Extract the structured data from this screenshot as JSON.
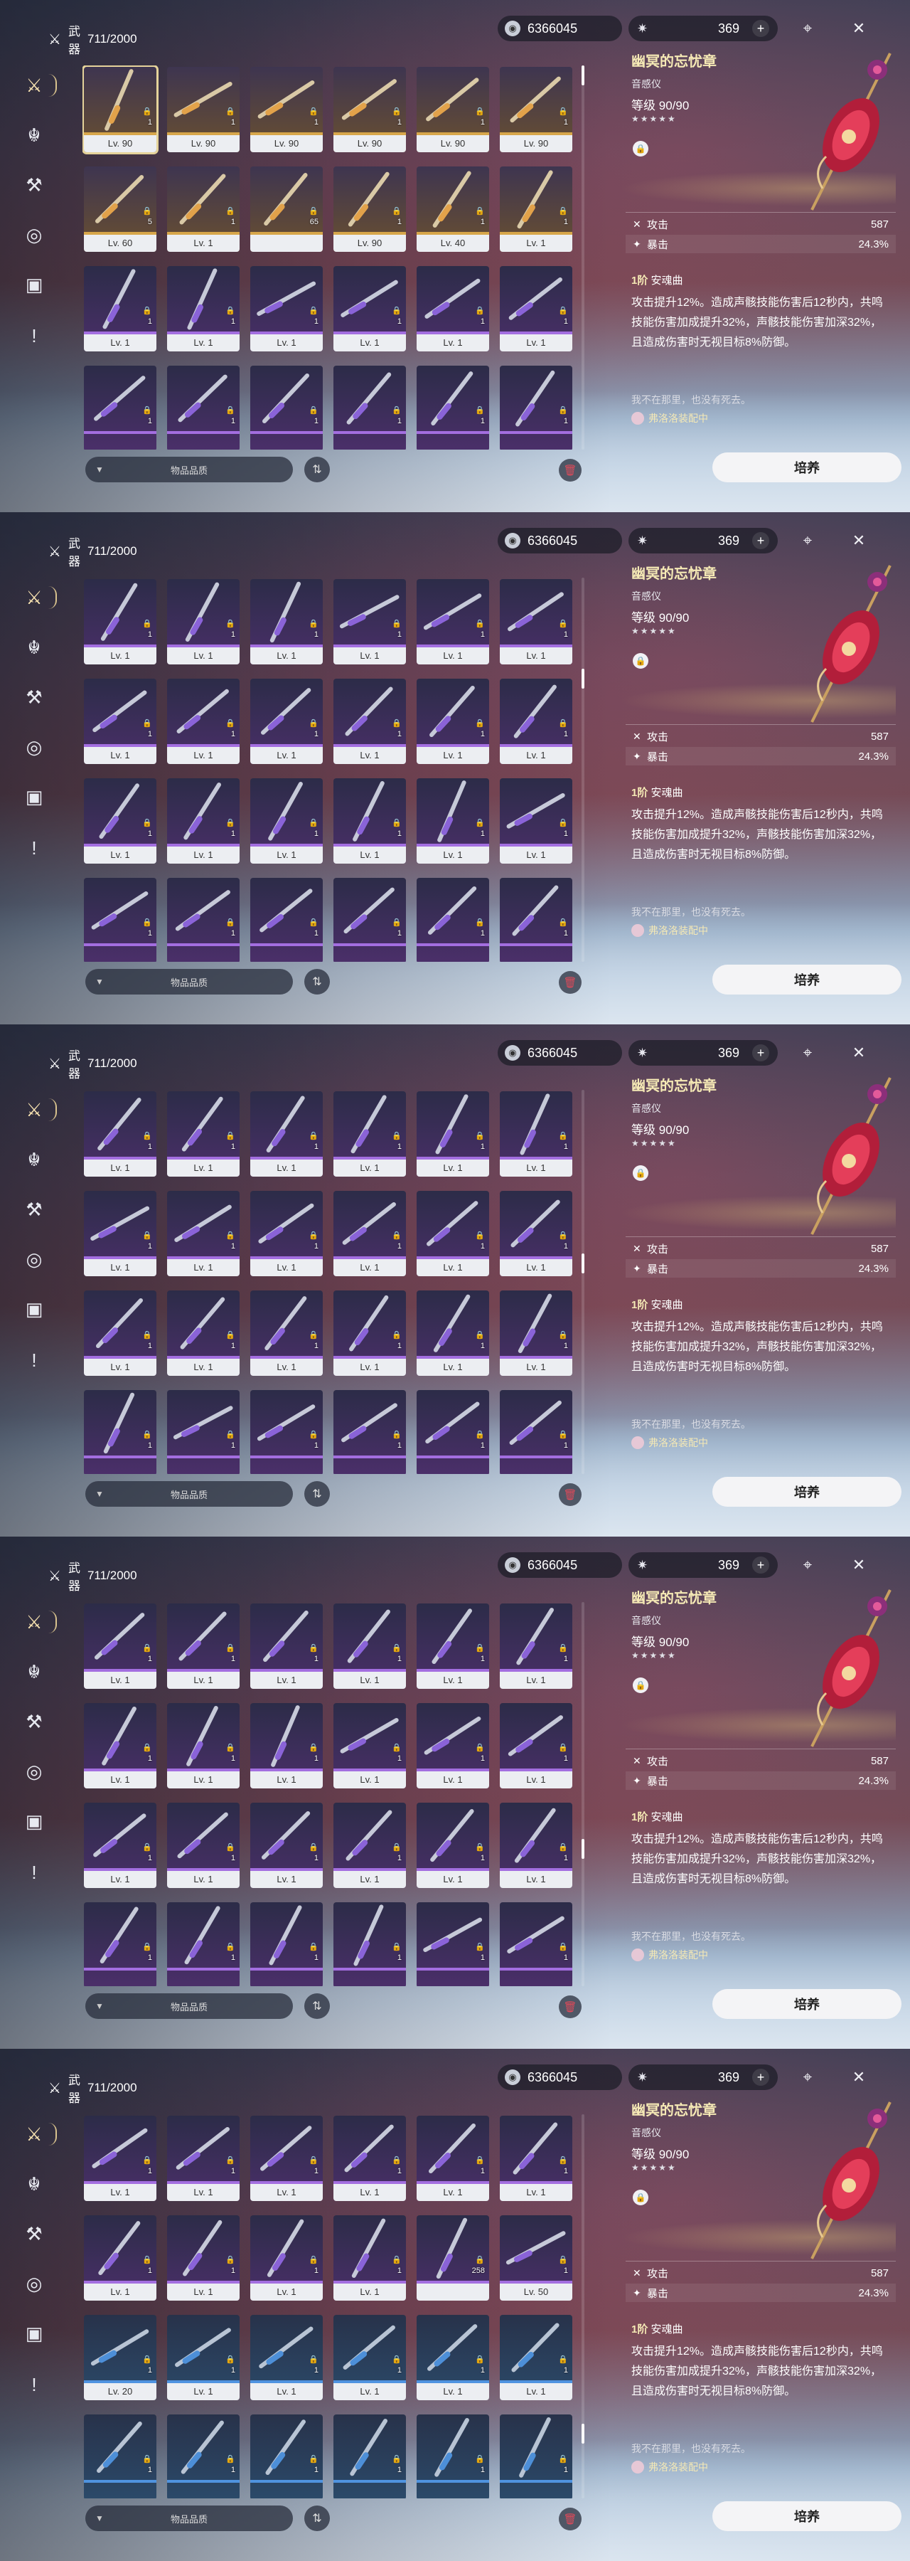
{
  "category": {
    "label": "武器",
    "count": "711/2000"
  },
  "currency": {
    "amount": "6366045"
  },
  "energy": {
    "amount": "369"
  },
  "filter_label": "物品品质",
  "cultivate_label": "培养",
  "weapon": {
    "name": "幽冥的忘忧章",
    "type": "音感仪",
    "level_label": "等级",
    "level": "90/90",
    "stars": "★★★★★",
    "stats": [
      {
        "name": "攻击",
        "value": "587"
      },
      {
        "name": "暴击",
        "value": "24.3%"
      }
    ],
    "rank": "1阶",
    "skill_name": "安魂曲",
    "skill_desc": "攻击提升12%。造成声骸技能伤害后12秒内，共鸣技能伤害加成提升32%，声骸技能伤害加深32%，且造成伤害时无视目标8%防御。",
    "flavor": "我不在那里，也没有死去。",
    "equipped": "弗洛洛装配中"
  },
  "colors": {
    "gold": "#d7a64a",
    "purple": "#a36ee0",
    "blue": "#4f93e0",
    "accent": "#f5e9b5"
  },
  "panels": [
    {
      "scroll": 0.0,
      "rows": [
        [
          [
            "q5",
            "Lv. 90",
            "1"
          ],
          [
            "q5",
            "Lv. 90",
            "1"
          ],
          [
            "q5",
            "Lv. 90",
            "1"
          ],
          [
            "q5",
            "Lv. 90",
            "1"
          ],
          [
            "q5",
            "Lv. 90",
            "1"
          ],
          [
            "q5",
            "Lv. 90",
            "1"
          ]
        ],
        [
          [
            "q5",
            "Lv. 60",
            "5"
          ],
          [
            "q5",
            "Lv. 1",
            "1"
          ],
          [
            "q5",
            "",
            "65"
          ],
          [
            "q5",
            "Lv. 90",
            "1"
          ],
          [
            "q5",
            "Lv. 40",
            "1"
          ],
          [
            "q5",
            "Lv. 1",
            "1"
          ]
        ],
        [
          [
            "q4",
            "Lv. 1",
            "1"
          ],
          [
            "q4",
            "Lv. 1",
            "1"
          ],
          [
            "q4",
            "Lv. 1",
            "1"
          ],
          [
            "q4",
            "Lv. 1",
            "1"
          ],
          [
            "q4",
            "Lv. 1",
            "1"
          ],
          [
            "q4",
            "Lv. 1",
            "1"
          ]
        ],
        [
          [
            "q4",
            "",
            "1"
          ],
          [
            "q4",
            "",
            "1"
          ],
          [
            "q4",
            "",
            "1"
          ],
          [
            "q4",
            "",
            "1"
          ],
          [
            "q4",
            "",
            "1"
          ],
          [
            "q4",
            "",
            "1"
          ]
        ]
      ]
    },
    {
      "scroll": 0.25,
      "rows": [
        [
          [
            "q4",
            "Lv. 1",
            "1"
          ],
          [
            "q4",
            "Lv. 1",
            "1"
          ],
          [
            "q4",
            "Lv. 1",
            "1"
          ],
          [
            "q4",
            "Lv. 1",
            "1"
          ],
          [
            "q4",
            "Lv. 1",
            "1"
          ],
          [
            "q4",
            "Lv. 1",
            "1"
          ]
        ],
        [
          [
            "q4",
            "Lv. 1",
            "1"
          ],
          [
            "q4",
            "Lv. 1",
            "1"
          ],
          [
            "q4",
            "Lv. 1",
            "1"
          ],
          [
            "q4",
            "Lv. 1",
            "1"
          ],
          [
            "q4",
            "Lv. 1",
            "1"
          ],
          [
            "q4",
            "Lv. 1",
            "1"
          ]
        ],
        [
          [
            "q4",
            "Lv. 1",
            "1"
          ],
          [
            "q4",
            "Lv. 1",
            "1"
          ],
          [
            "q4",
            "Lv. 1",
            "1"
          ],
          [
            "q4",
            "Lv. 1",
            "1"
          ],
          [
            "q4",
            "Lv. 1",
            "1"
          ],
          [
            "q4",
            "Lv. 1",
            "1"
          ]
        ],
        [
          [
            "q4",
            "",
            "1"
          ],
          [
            "q4",
            "",
            "1"
          ],
          [
            "q4",
            "",
            "1"
          ],
          [
            "q4",
            "",
            "1"
          ],
          [
            "q4",
            "",
            "1"
          ],
          [
            "q4",
            "",
            "1"
          ]
        ]
      ]
    },
    {
      "scroll": 0.45,
      "rows": [
        [
          [
            "q4",
            "Lv. 1",
            "1"
          ],
          [
            "q4",
            "Lv. 1",
            "1"
          ],
          [
            "q4",
            "Lv. 1",
            "1"
          ],
          [
            "q4",
            "Lv. 1",
            "1"
          ],
          [
            "q4",
            "Lv. 1",
            "1"
          ],
          [
            "q4",
            "Lv. 1",
            "1"
          ]
        ],
        [
          [
            "q4",
            "Lv. 1",
            "1"
          ],
          [
            "q4",
            "Lv. 1",
            "1"
          ],
          [
            "q4",
            "Lv. 1",
            "1"
          ],
          [
            "q4",
            "Lv. 1",
            "1"
          ],
          [
            "q4",
            "Lv. 1",
            "1"
          ],
          [
            "q4",
            "Lv. 1",
            "1"
          ]
        ],
        [
          [
            "q4",
            "Lv. 1",
            "1"
          ],
          [
            "q4",
            "Lv. 1",
            "1"
          ],
          [
            "q4",
            "Lv. 1",
            "1"
          ],
          [
            "q4",
            "Lv. 1",
            "1"
          ],
          [
            "q4",
            "Lv. 1",
            "1"
          ],
          [
            "q4",
            "Lv. 1",
            "1"
          ]
        ],
        [
          [
            "q4",
            "",
            "1"
          ],
          [
            "q4",
            "",
            "1"
          ],
          [
            "q4",
            "",
            "1"
          ],
          [
            "q4",
            "",
            "1"
          ],
          [
            "q4",
            "",
            "1"
          ],
          [
            "q4",
            "",
            "1"
          ]
        ]
      ]
    },
    {
      "scroll": 0.65,
      "rows": [
        [
          [
            "q4",
            "Lv. 1",
            "1"
          ],
          [
            "q4",
            "Lv. 1",
            "1"
          ],
          [
            "q4",
            "Lv. 1",
            "1"
          ],
          [
            "q4",
            "Lv. 1",
            "1"
          ],
          [
            "q4",
            "Lv. 1",
            "1"
          ],
          [
            "q4",
            "Lv. 1",
            "1"
          ]
        ],
        [
          [
            "q4",
            "Lv. 1",
            "1"
          ],
          [
            "q4",
            "Lv. 1",
            "1"
          ],
          [
            "q4",
            "Lv. 1",
            "1"
          ],
          [
            "q4",
            "Lv. 1",
            "1"
          ],
          [
            "q4",
            "Lv. 1",
            "1"
          ],
          [
            "q4",
            "Lv. 1",
            "1"
          ]
        ],
        [
          [
            "q4",
            "Lv. 1",
            "1"
          ],
          [
            "q4",
            "Lv. 1",
            "1"
          ],
          [
            "q4",
            "Lv. 1",
            "1"
          ],
          [
            "q4",
            "Lv. 1",
            "1"
          ],
          [
            "q4",
            "Lv. 1",
            "1"
          ],
          [
            "q4",
            "Lv. 1",
            "1"
          ]
        ],
        [
          [
            "q4",
            "",
            "1"
          ],
          [
            "q4",
            "",
            "1"
          ],
          [
            "q4",
            "",
            "1"
          ],
          [
            "q4",
            "",
            "1"
          ],
          [
            "q4",
            "",
            "1"
          ],
          [
            "q4",
            "",
            "1"
          ]
        ]
      ]
    },
    {
      "scroll": 0.85,
      "rows": [
        [
          [
            "q4",
            "Lv. 1",
            "1"
          ],
          [
            "q4",
            "Lv. 1",
            "1"
          ],
          [
            "q4",
            "Lv. 1",
            "1"
          ],
          [
            "q4",
            "Lv. 1",
            "1"
          ],
          [
            "q4",
            "Lv. 1",
            "1"
          ],
          [
            "q4",
            "Lv. 1",
            "1"
          ]
        ],
        [
          [
            "q4",
            "Lv. 1",
            "1"
          ],
          [
            "q4",
            "Lv. 1",
            "1"
          ],
          [
            "q4",
            "Lv. 1",
            "1"
          ],
          [
            "q4",
            "Lv. 1",
            "1"
          ],
          [
            "q4",
            "",
            "258"
          ],
          [
            "q4",
            "Lv. 50",
            "1"
          ]
        ],
        [
          [
            "q3",
            "Lv. 20",
            "1"
          ],
          [
            "q3",
            "Lv. 1",
            "1"
          ],
          [
            "q3",
            "Lv. 1",
            "1"
          ],
          [
            "q3",
            "Lv. 1",
            "1"
          ],
          [
            "q3",
            "Lv. 1",
            "1"
          ],
          [
            "q3",
            "Lv. 1",
            "1"
          ]
        ],
        [
          [
            "q3",
            "",
            "1"
          ],
          [
            "q3",
            "",
            "1"
          ],
          [
            "q3",
            "",
            "1"
          ],
          [
            "q3",
            "",
            "1"
          ],
          [
            "q3",
            "",
            "1"
          ],
          [
            "q3",
            "",
            "1"
          ]
        ]
      ]
    }
  ]
}
